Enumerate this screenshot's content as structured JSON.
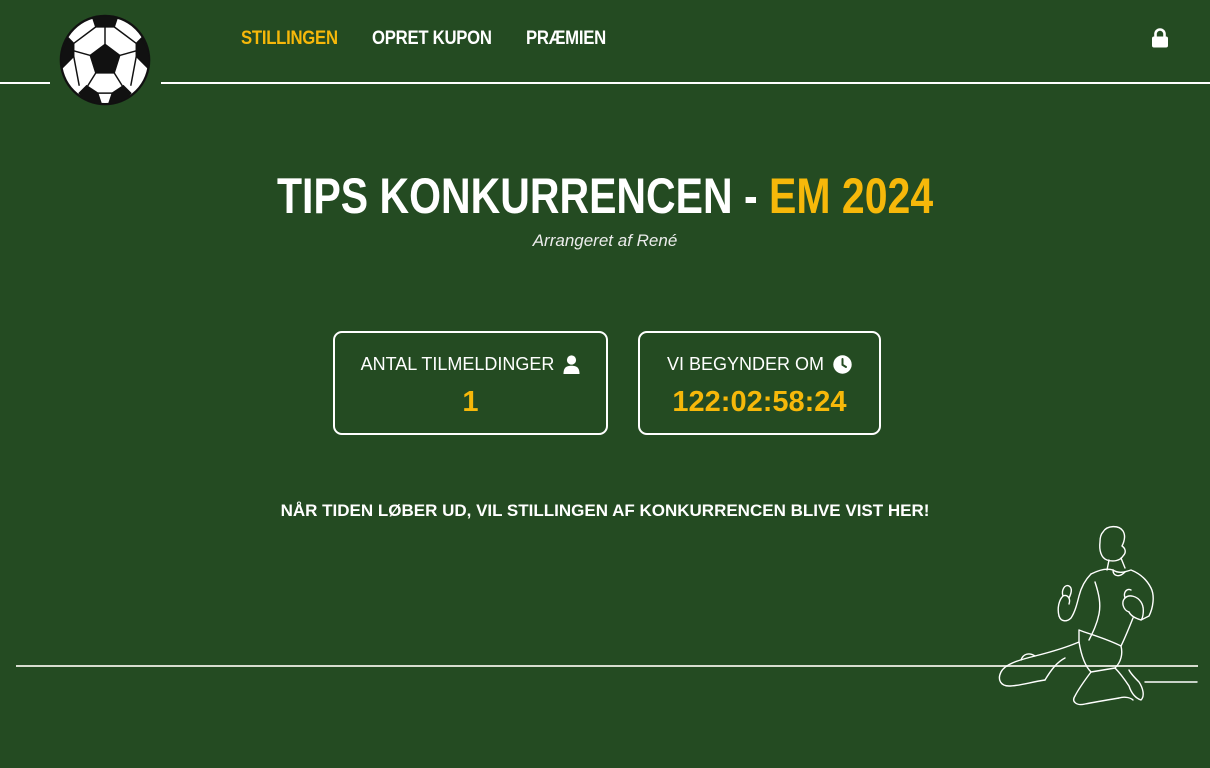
{
  "nav": {
    "items": [
      {
        "label": "STILLINGEN",
        "active": true
      },
      {
        "label": "OPRET KUPON",
        "active": false
      },
      {
        "label": "PRÆMIEN",
        "active": false
      }
    ],
    "lock_icon": "lock-icon"
  },
  "hero": {
    "title_main": "TIPS KONKURRENCEN - ",
    "title_accent": "EM 2024",
    "subtitle": "Arrangeret af René"
  },
  "stats": {
    "signups_label": "ANTAL TILMELDINGER",
    "signups_icon": "user-icon",
    "signups_value": "1",
    "countdown_label": "VI BEGYNDER OM",
    "countdown_icon": "clock-icon",
    "countdown_value": "122:02:58:24"
  },
  "notice": "NÅR TIDEN LØBER UD, VIL STILLINGEN AF KONKURRENCEN BLIVE VIST HER!",
  "colors": {
    "background": "#244b22",
    "accent": "#f6b80a",
    "text": "#ffffff"
  }
}
